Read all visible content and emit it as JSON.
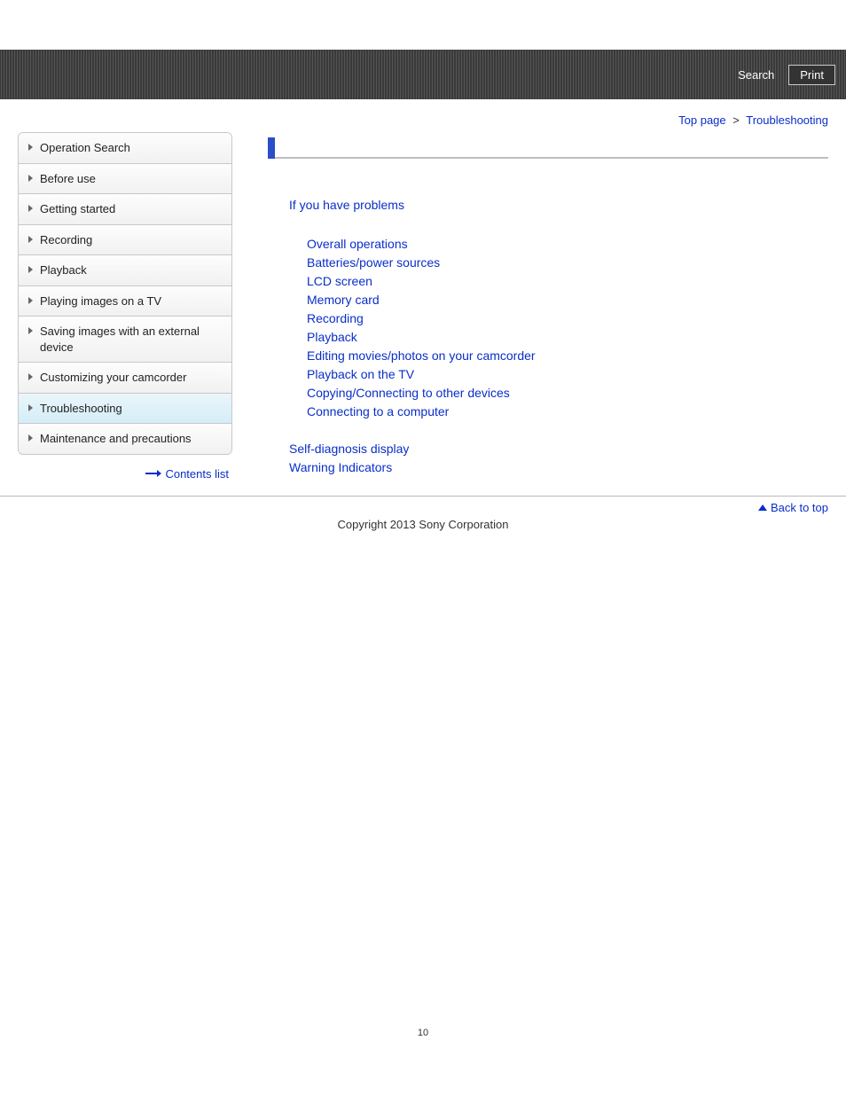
{
  "header": {
    "search_label": "Search",
    "print_label": "Print"
  },
  "breadcrumb": {
    "top_label": "Top page",
    "separator": ">",
    "current": "Troubleshooting"
  },
  "sidebar": {
    "items": [
      {
        "label": "Operation Search"
      },
      {
        "label": "Before use"
      },
      {
        "label": "Getting started"
      },
      {
        "label": "Recording"
      },
      {
        "label": "Playback"
      },
      {
        "label": "Playing images on a TV"
      },
      {
        "label": "Saving images with an external device"
      },
      {
        "label": "Customizing your camcorder"
      },
      {
        "label": "Troubleshooting"
      },
      {
        "label": "Maintenance and precautions"
      }
    ],
    "contents_list_label": "Contents list"
  },
  "main": {
    "section_head": "If you have problems",
    "links": [
      "Overall operations",
      "Batteries/power sources",
      "LCD screen",
      "Memory card",
      "Recording",
      "Playback",
      "Editing movies/photos on your camcorder",
      "Playback on the TV",
      "Copying/Connecting to other devices",
      "Connecting to a computer"
    ],
    "extra_links": [
      "Self-diagnosis display",
      "Warning Indicators"
    ]
  },
  "footer": {
    "back_to_top": "Back to top",
    "copyright": "Copyright 2013 Sony Corporation"
  },
  "page_number": "10"
}
